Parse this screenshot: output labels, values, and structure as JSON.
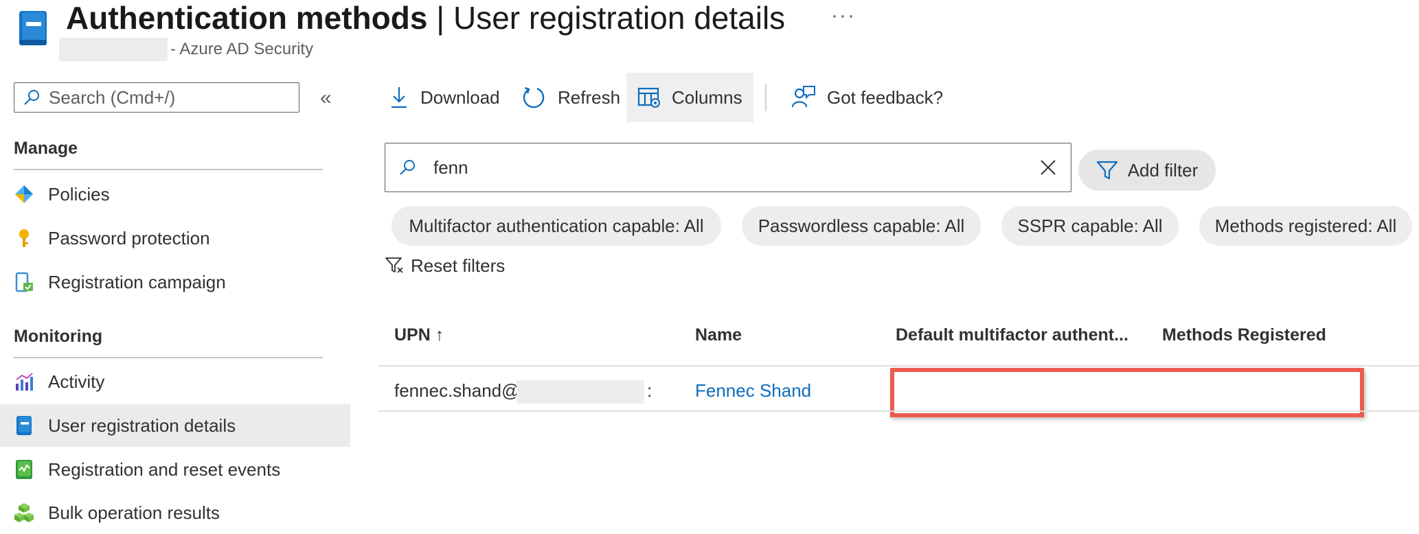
{
  "header": {
    "title_bold": "Authentication methods",
    "title_sep": " | ",
    "title_light": "User registration details",
    "more": "···",
    "subtitle": "- Azure AD Security"
  },
  "sidebar": {
    "search_placeholder": "Search (Cmd+/)",
    "collapse": "«",
    "sections": [
      {
        "heading": "Manage",
        "items": [
          {
            "label": "Policies",
            "icon": "policies-icon"
          },
          {
            "label": "Password protection",
            "icon": "key-icon"
          },
          {
            "label": "Registration campaign",
            "icon": "phone-check-icon"
          }
        ]
      },
      {
        "heading": "Monitoring",
        "items": [
          {
            "label": "Activity",
            "icon": "activity-chart-icon"
          },
          {
            "label": "User registration details",
            "icon": "book-icon",
            "selected": true
          },
          {
            "label": "Registration and reset events",
            "icon": "events-log-icon"
          },
          {
            "label": "Bulk operation results",
            "icon": "cubes-icon"
          }
        ]
      }
    ]
  },
  "toolbar": {
    "download": "Download",
    "refresh": "Refresh",
    "columns": "Columns",
    "feedback": "Got feedback?"
  },
  "filter": {
    "search_value": "fenn",
    "add_filter": "Add filter",
    "pills": [
      "Multifactor authentication capable: All",
      "Passwordless capable: All",
      "SSPR capable: All",
      "Methods registered: All"
    ],
    "reset": "Reset filters"
  },
  "table": {
    "columns": [
      "UPN ↑",
      "Name",
      "Default multifactor authent...",
      "Methods Registered"
    ],
    "rows": [
      {
        "upn_prefix": "fennec.shand@",
        "upn_suffix": ":",
        "name": "Fennec Shand",
        "default_mfa": "",
        "methods": ""
      }
    ]
  },
  "colors": {
    "accent": "#0f6cbd",
    "highlight_border": "#ec5b50",
    "selected_bg": "#ebebeb",
    "pill_bg": "#ededed"
  }
}
